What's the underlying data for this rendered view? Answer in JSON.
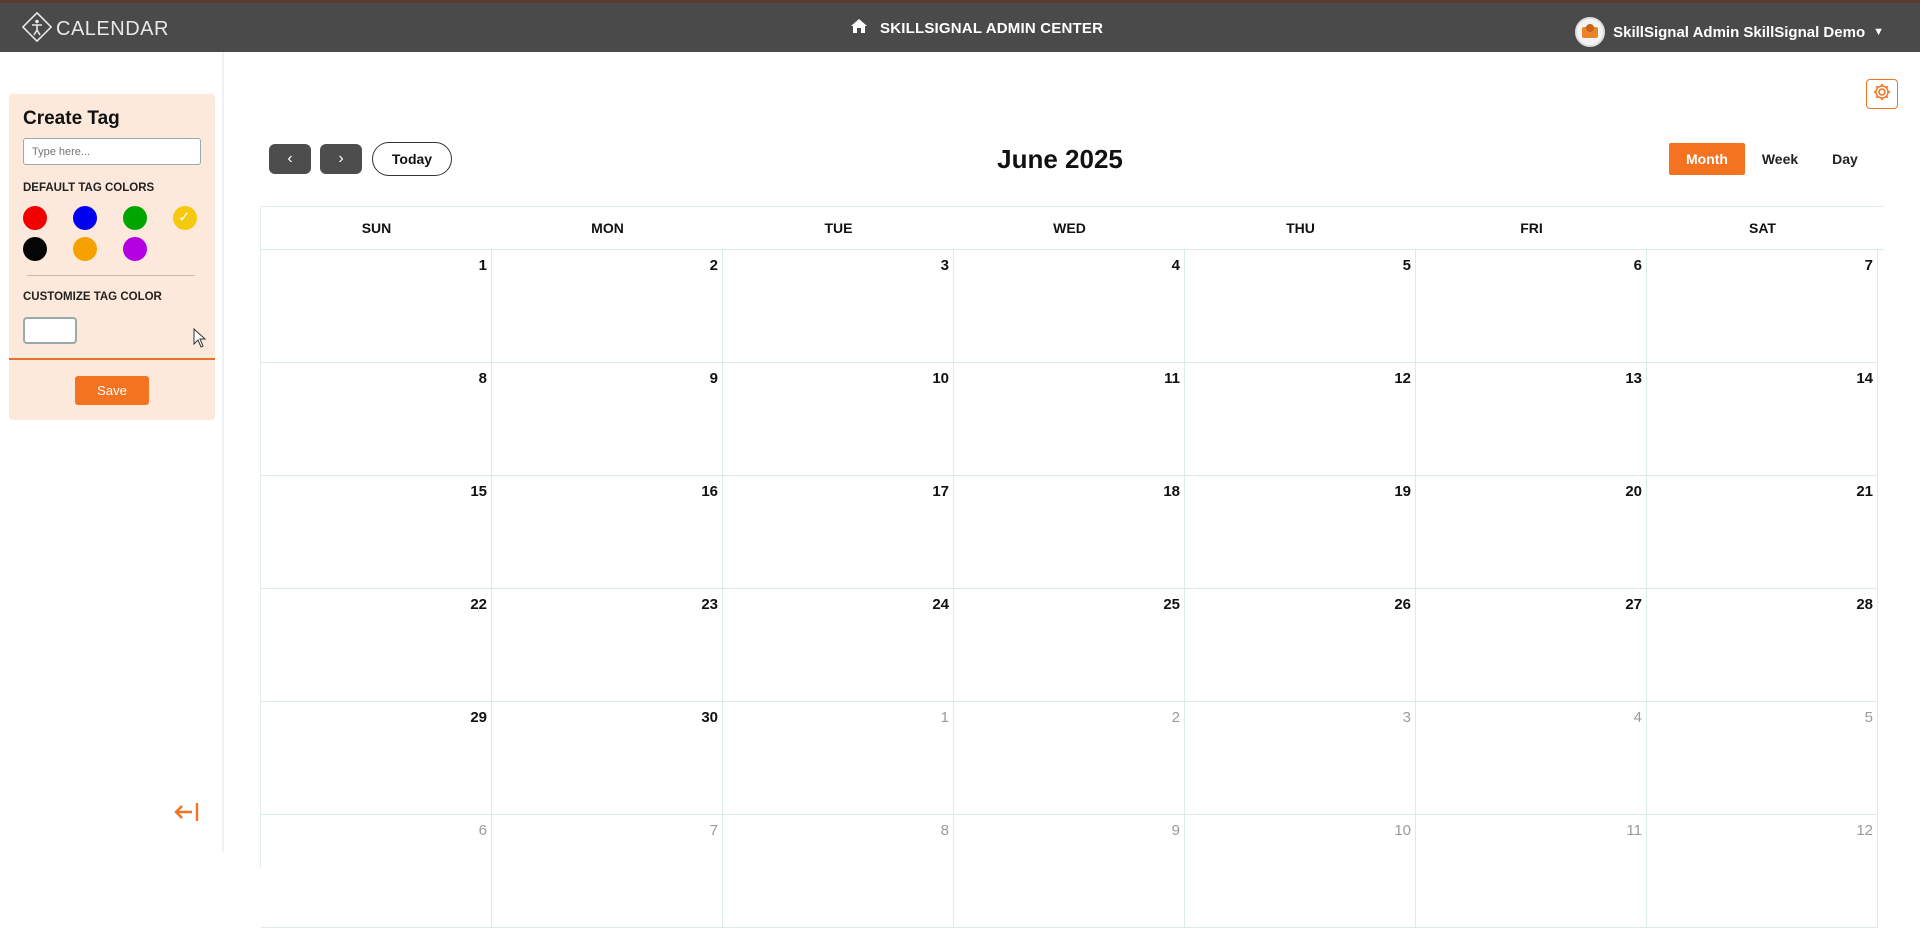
{
  "topbar": {
    "app_name": "CALENDAR",
    "center_title": "SKILLSIGNAL ADMIN CENTER",
    "user_name": "SkillSignal Admin SkillSignal Demo",
    "icons": {
      "logo": "figure-diamond-icon",
      "home": "home-icon",
      "user_menu": "caret-down-icon"
    }
  },
  "sidebar": {
    "create_tag": {
      "title": "Create Tag",
      "input_placeholder": "Type here...",
      "default_colors_label": "DEFAULT TAG COLORS",
      "default_colors": [
        "#f20000",
        "#0000ee",
        "#00a600",
        "#f7c90e",
        "#050505",
        "#f5a200",
        "#b400e0"
      ],
      "selected_color": "#f7c90e",
      "customize_label": "CUSTOMIZE TAG COLOR",
      "save_label": "Save"
    },
    "collapse_icon": "arrow-left-bar-icon"
  },
  "toolbar": {
    "prev_label": "‹",
    "next_label": "›",
    "today_label": "Today",
    "month_title": "June 2025",
    "views": [
      "Month",
      "Week",
      "Day"
    ],
    "active_view": "Month",
    "settings_icon": "gear-icon"
  },
  "calendar": {
    "weekdays": [
      "SUN",
      "MON",
      "TUE",
      "WED",
      "THU",
      "FRI",
      "SAT"
    ],
    "weeks": [
      [
        {
          "d": "1"
        },
        {
          "d": "2"
        },
        {
          "d": "3"
        },
        {
          "d": "4"
        },
        {
          "d": "5"
        },
        {
          "d": "6"
        },
        {
          "d": "7"
        }
      ],
      [
        {
          "d": "8"
        },
        {
          "d": "9"
        },
        {
          "d": "10"
        },
        {
          "d": "11"
        },
        {
          "d": "12"
        },
        {
          "d": "13"
        },
        {
          "d": "14"
        }
      ],
      [
        {
          "d": "15"
        },
        {
          "d": "16"
        },
        {
          "d": "17"
        },
        {
          "d": "18"
        },
        {
          "d": "19"
        },
        {
          "d": "20"
        },
        {
          "d": "21"
        }
      ],
      [
        {
          "d": "22"
        },
        {
          "d": "23"
        },
        {
          "d": "24"
        },
        {
          "d": "25"
        },
        {
          "d": "26"
        },
        {
          "d": "27"
        },
        {
          "d": "28"
        }
      ],
      [
        {
          "d": "29"
        },
        {
          "d": "30"
        },
        {
          "d": "1",
          "other": true
        },
        {
          "d": "2",
          "other": true
        },
        {
          "d": "3",
          "other": true
        },
        {
          "d": "4",
          "other": true
        },
        {
          "d": "5",
          "other": true
        }
      ],
      [
        {
          "d": "6",
          "other": true
        },
        {
          "d": "7",
          "other": true
        },
        {
          "d": "8",
          "other": true
        },
        {
          "d": "9",
          "other": true
        },
        {
          "d": "10",
          "other": true
        },
        {
          "d": "11",
          "other": true
        },
        {
          "d": "12",
          "other": true
        }
      ]
    ]
  },
  "colors": {
    "accent": "#f37321",
    "topbar": "#4a4a4a",
    "panel": "#fde9dc"
  }
}
